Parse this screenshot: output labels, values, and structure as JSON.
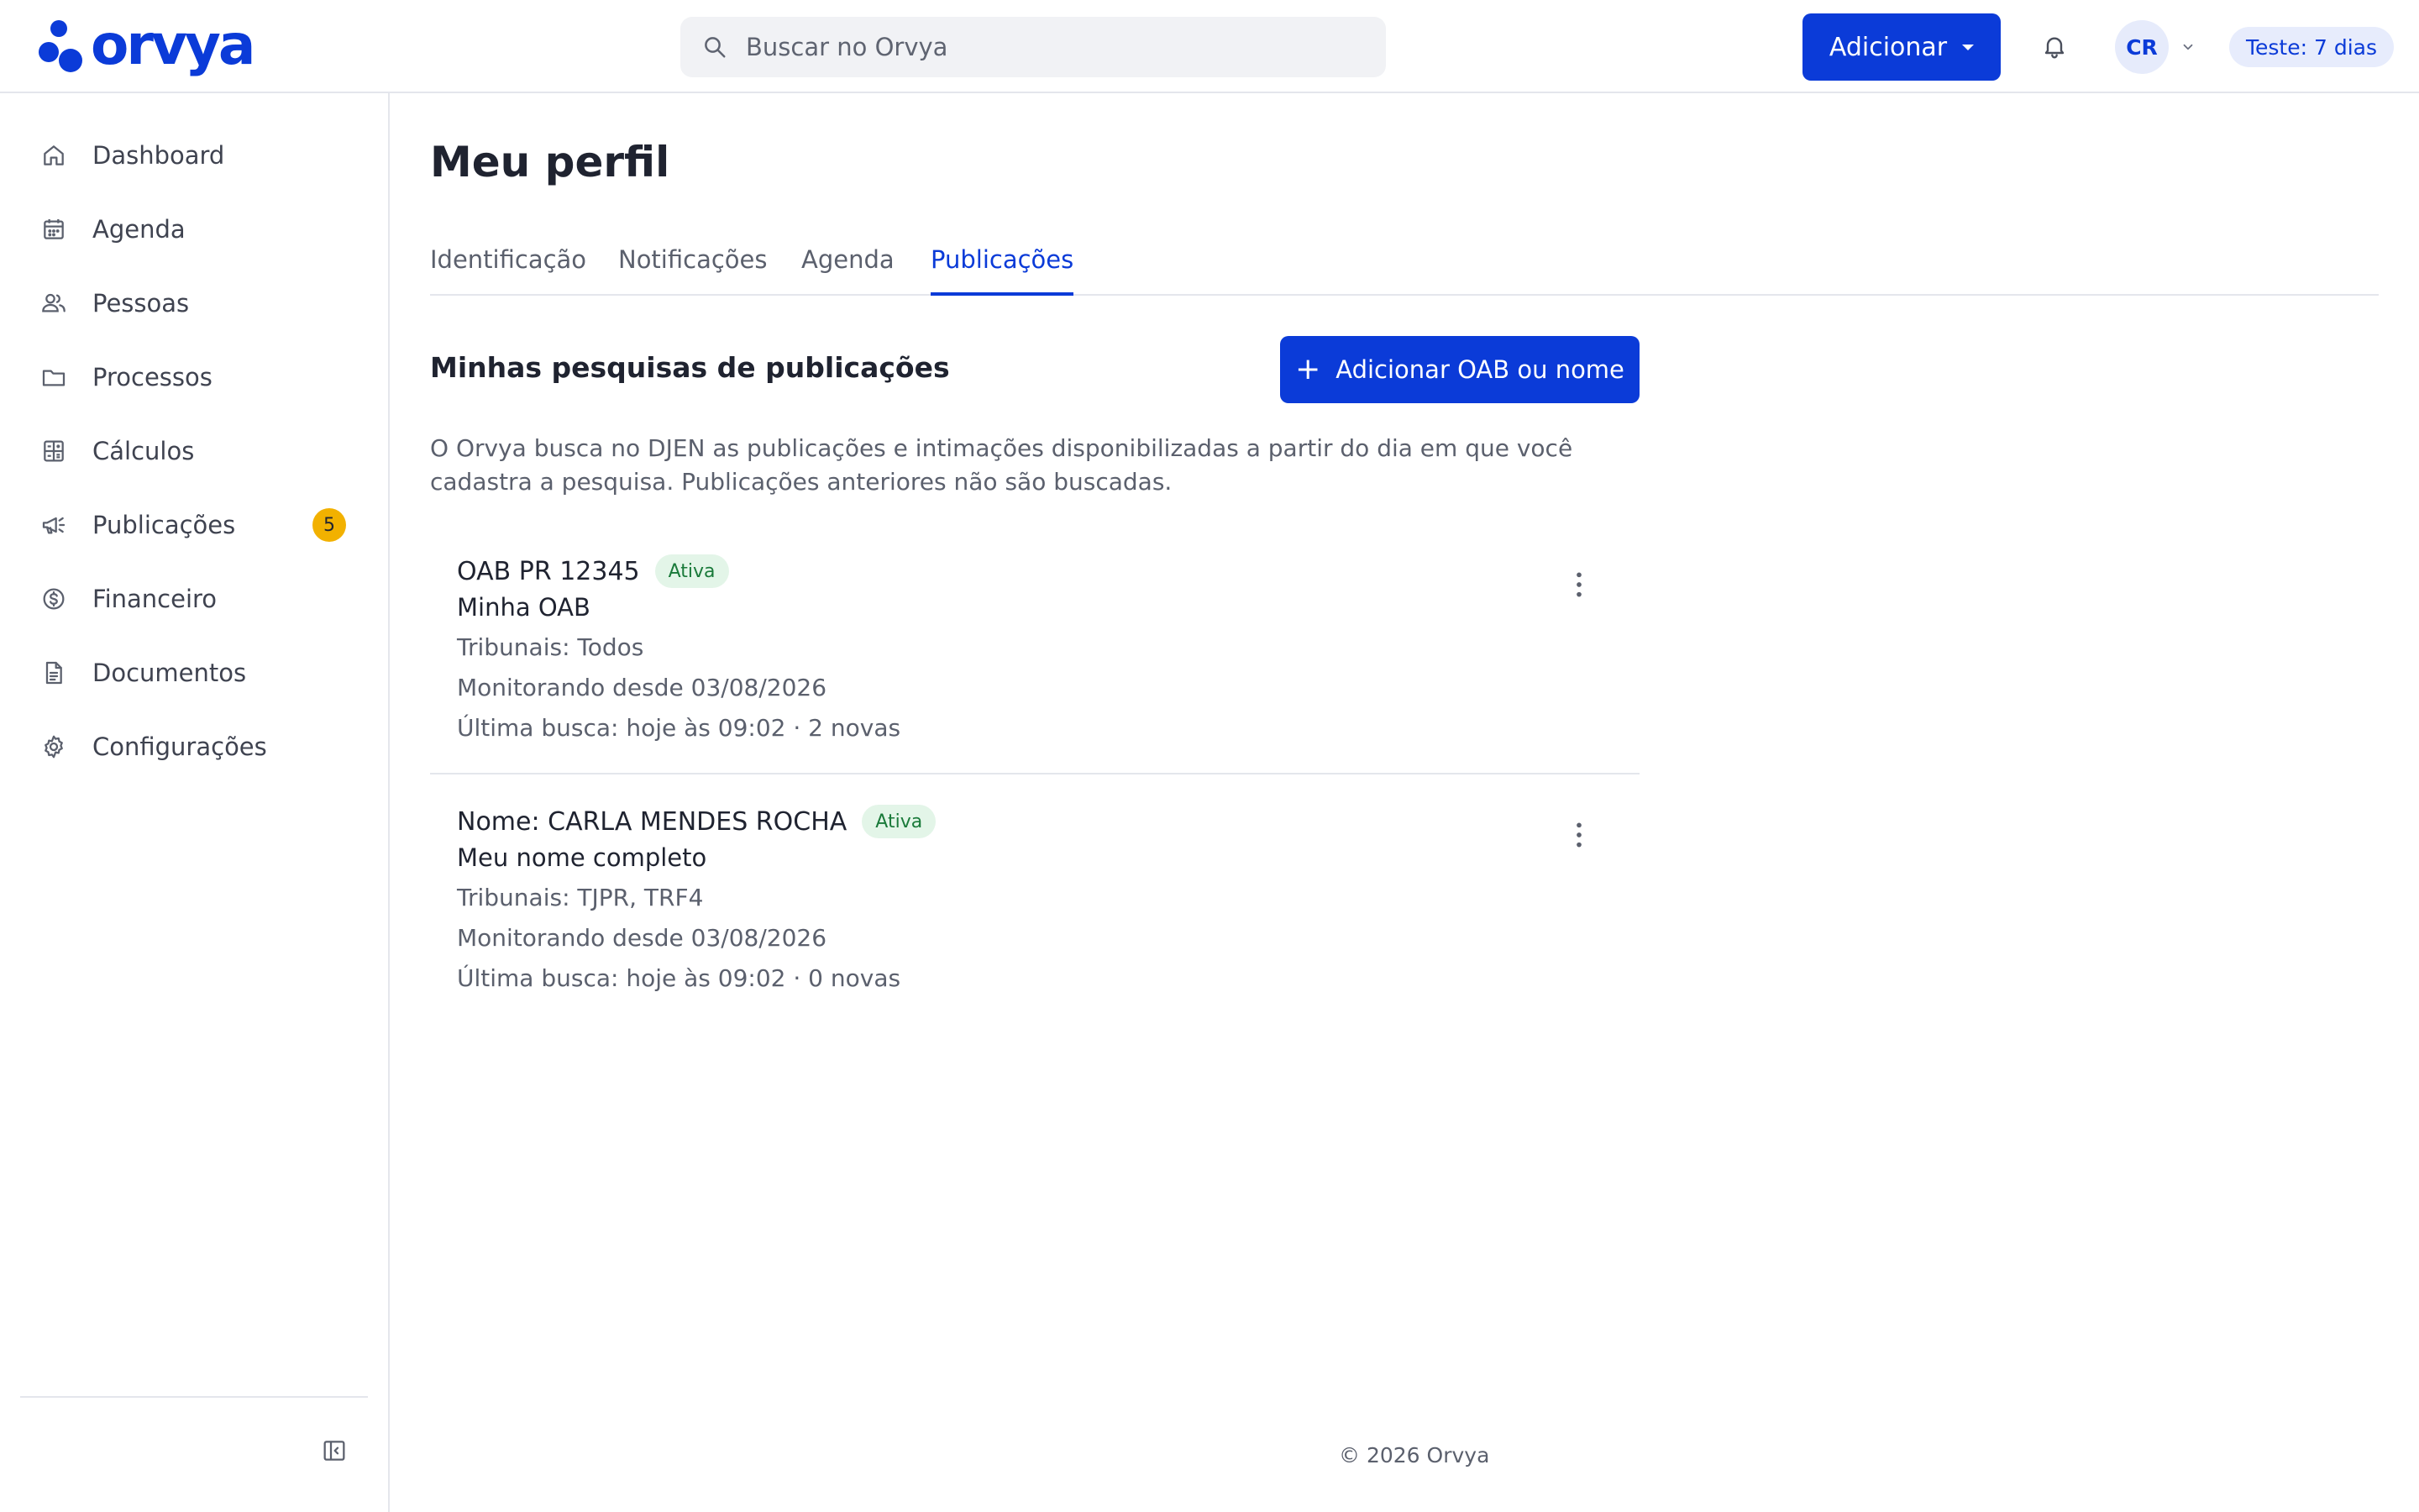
{
  "header": {
    "logo_text": "orvya",
    "search_placeholder": "Buscar no Orvya",
    "add_button_label": "Adicionar",
    "avatar_initials": "CR",
    "trial_badge": "Teste: 7 dias"
  },
  "sidebar": {
    "items": [
      {
        "label": "Dashboard",
        "icon": "home-icon"
      },
      {
        "label": "Agenda",
        "icon": "calendar-icon"
      },
      {
        "label": "Pessoas",
        "icon": "people-icon"
      },
      {
        "label": "Processos",
        "icon": "folder-icon"
      },
      {
        "label": "Cálculos",
        "icon": "calculator-icon"
      },
      {
        "label": "Publicações",
        "icon": "megaphone-icon",
        "badge": "5"
      },
      {
        "label": "Financeiro",
        "icon": "dollar-icon"
      },
      {
        "label": "Documentos",
        "icon": "document-icon"
      },
      {
        "label": "Configurações",
        "icon": "gear-icon"
      }
    ]
  },
  "main": {
    "page_title": "Meu perfil",
    "tabs": [
      {
        "label": "Identificação"
      },
      {
        "label": "Notificações"
      },
      {
        "label": "Agenda"
      },
      {
        "label": "Publicações",
        "active": true
      }
    ],
    "section_title": "Minhas pesquisas de publicações",
    "add_oab_button": "Adicionar OAB ou nome",
    "description": "O Orvya busca no DJEN as publicações e intimações disponibilizadas a partir do dia em que você cadastra a pesquisa. Publicações anteriores não são buscadas.",
    "searches": [
      {
        "title": "OAB PR 12345",
        "status": "Ativa",
        "label": "Minha OAB",
        "courts": "Tribunais: Todos",
        "since": "Monitorando desde 03/08/2026",
        "last_search": "Última busca: hoje às 09:02 · 2 novas"
      },
      {
        "title": "Nome: CARLA MENDES ROCHA",
        "status": "Ativa",
        "label": "Meu nome completo",
        "courts": "Tribunais: TJPR, TRF4",
        "since": "Monitorando desde 03/08/2026",
        "last_search": "Última busca: hoje às 09:02 · 0 novas"
      }
    ]
  },
  "footer": {
    "text": "© 2026 Orvya"
  },
  "colors": {
    "brand": "#0b3bd8",
    "badge": "#f2b100",
    "status_bg": "#e3f5e8",
    "status_text": "#1a7a3a"
  }
}
